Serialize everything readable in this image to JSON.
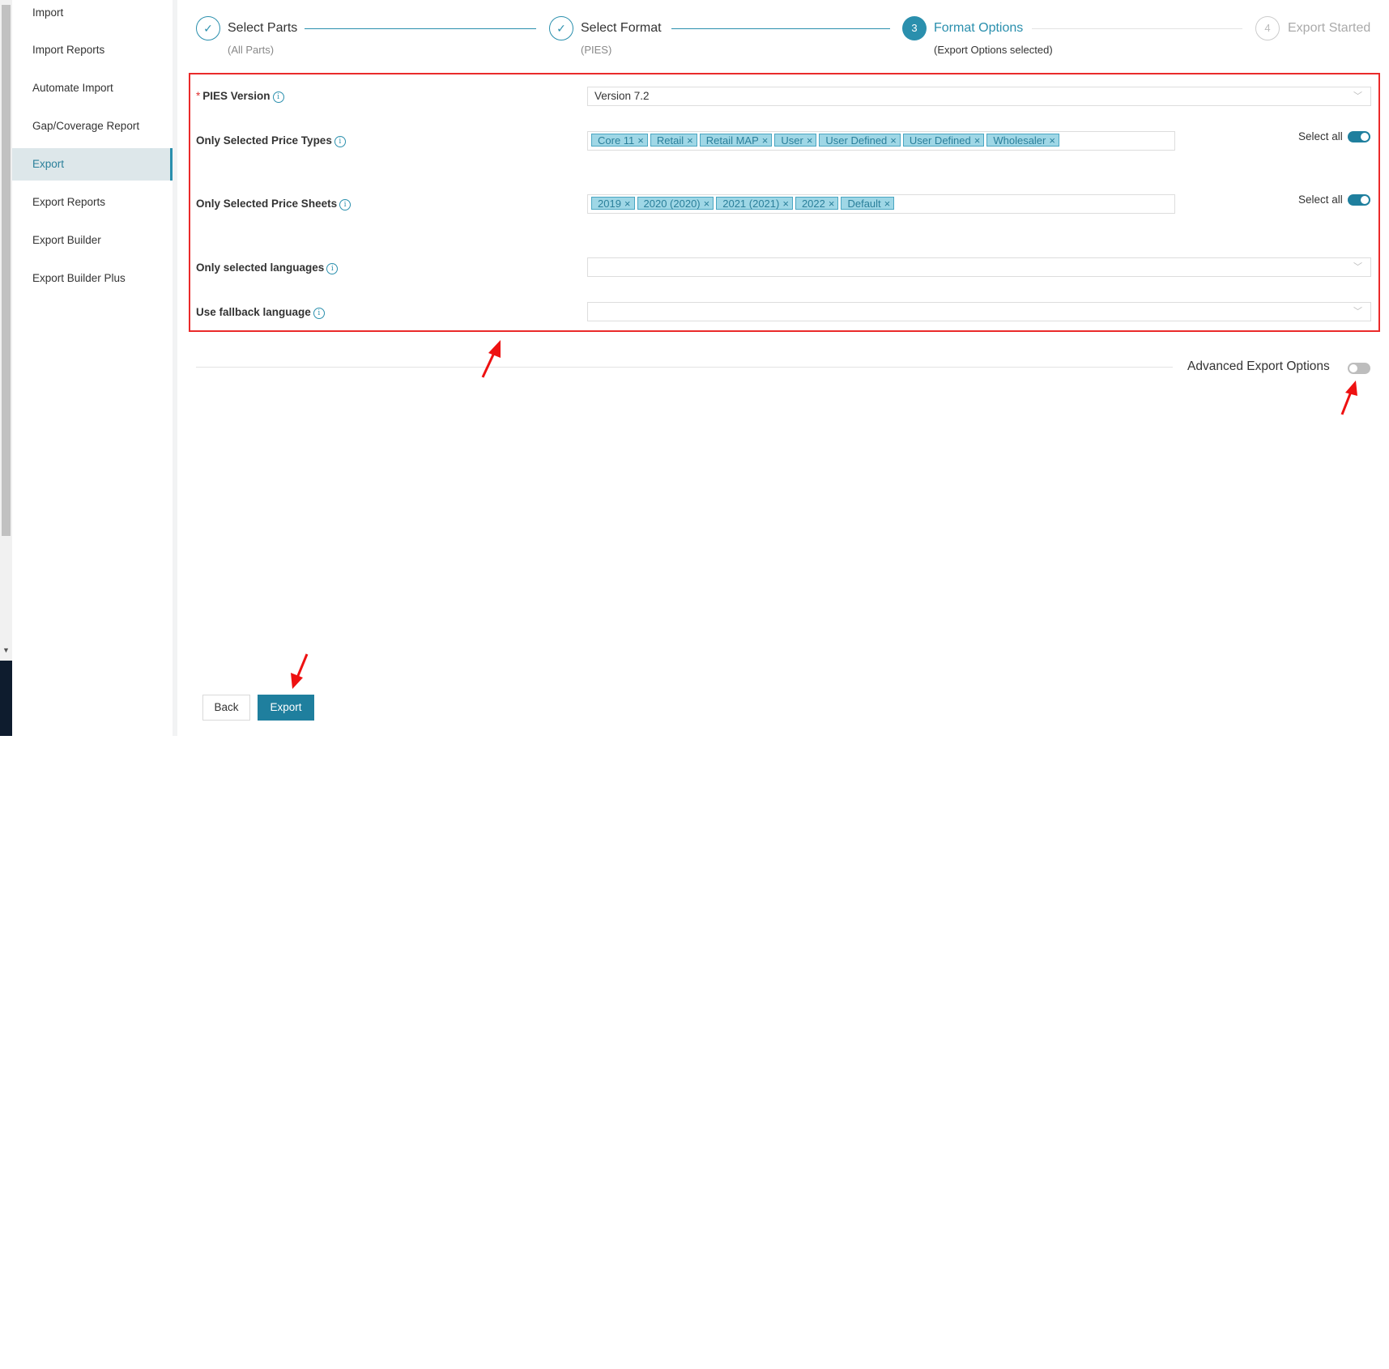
{
  "sidebar": {
    "items": [
      {
        "label": "Import"
      },
      {
        "label": "Import Reports"
      },
      {
        "label": "Automate Import"
      },
      {
        "label": "Gap/Coverage Report"
      },
      {
        "label": "Export"
      },
      {
        "label": "Export Reports"
      },
      {
        "label": "Export Builder"
      },
      {
        "label": "Export Builder Plus"
      }
    ]
  },
  "stepper": {
    "steps": [
      {
        "number": "1",
        "title": "Select Parts",
        "subtitle": "(All Parts)",
        "state": "done"
      },
      {
        "number": "2",
        "title": "Select Format",
        "subtitle": "(PIES)",
        "state": "done"
      },
      {
        "number": "3",
        "title": "Format Options",
        "subtitle": "(Export Options selected)",
        "state": "current"
      },
      {
        "number": "4",
        "title": "Export Started",
        "subtitle": "",
        "state": "todo"
      }
    ]
  },
  "form": {
    "pies_version": {
      "label": "PIES Version",
      "value": "Version 7.2",
      "required_mark": "*"
    },
    "price_types": {
      "label": "Only Selected Price Types",
      "tags": [
        "Core 11",
        "Retail",
        "Retail MAP",
        "User",
        "User Defined",
        "User Defined",
        "Wholesaler"
      ],
      "select_all_label": "Select all",
      "select_all_on": true
    },
    "price_sheets": {
      "label": "Only Selected Price Sheets",
      "tags": [
        "2019",
        "2020 (2020)",
        "2021 (2021)",
        "2022",
        "Default"
      ],
      "select_all_label": "Select all",
      "select_all_on": true
    },
    "languages": {
      "label": "Only selected languages",
      "value": ""
    },
    "fallback_language": {
      "label": "Use fallback language",
      "value": ""
    }
  },
  "advanced": {
    "label": "Advanced Export Options",
    "enabled": false
  },
  "actions": {
    "back_label": "Back",
    "export_label": "Export"
  },
  "colors": {
    "accent": "#1f7f9e",
    "highlight_border": "#ea2a2a",
    "annotation_arrow": "#ee1111"
  }
}
